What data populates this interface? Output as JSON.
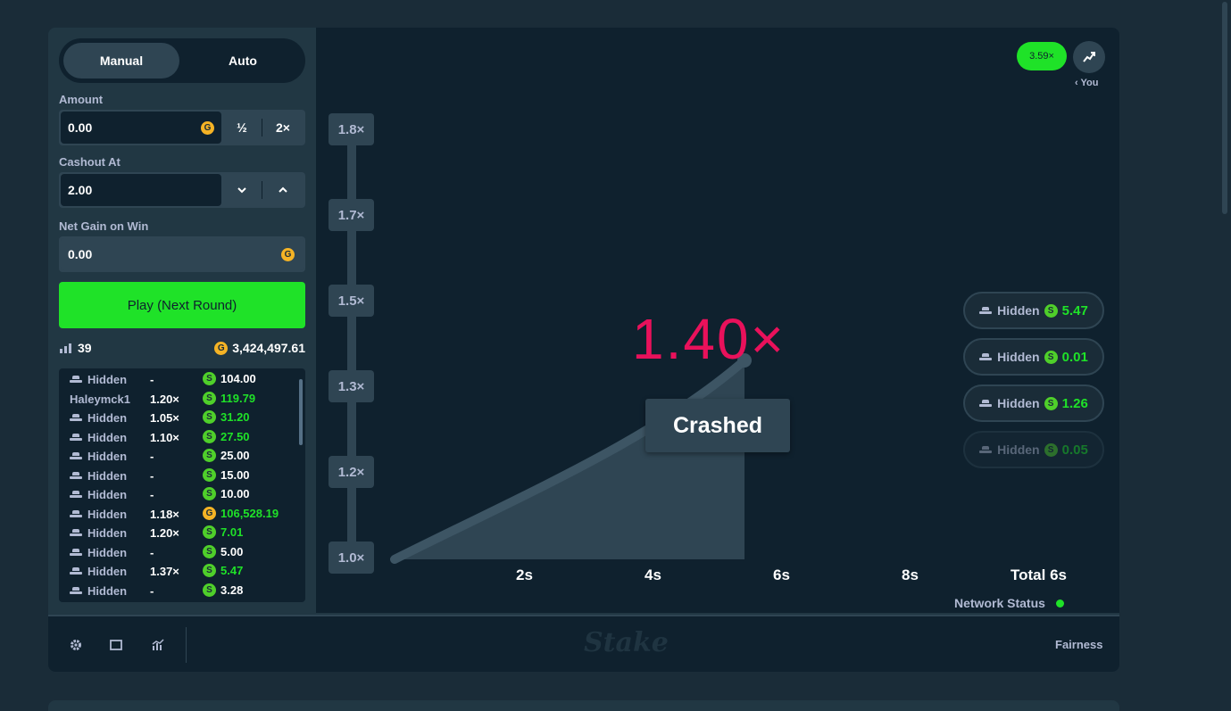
{
  "controls": {
    "tab_manual": "Manual",
    "tab_auto": "Auto",
    "amount_label": "Amount",
    "amount_value": "0.00",
    "half_label": "½",
    "double_label": "2×",
    "cashout_label": "Cashout At",
    "cashout_value": "2.00",
    "net_gain_label": "Net Gain on Win",
    "net_gain_value": "0.00",
    "play_label": "Play (Next Round)",
    "coin_g": "G",
    "coin_s": "S"
  },
  "stats": {
    "players": "39",
    "total": "3,424,497.61"
  },
  "bets": [
    {
      "name": "Hidden",
      "hidden": true,
      "mult": "-",
      "coin": "S",
      "amount": "104.00",
      "won": false
    },
    {
      "name": "Haleymck1",
      "hidden": false,
      "mult": "1.20×",
      "coin": "S",
      "amount": "119.79",
      "won": true
    },
    {
      "name": "Hidden",
      "hidden": true,
      "mult": "1.05×",
      "coin": "S",
      "amount": "31.20",
      "won": true
    },
    {
      "name": "Hidden",
      "hidden": true,
      "mult": "1.10×",
      "coin": "S",
      "amount": "27.50",
      "won": true
    },
    {
      "name": "Hidden",
      "hidden": true,
      "mult": "-",
      "coin": "S",
      "amount": "25.00",
      "won": false
    },
    {
      "name": "Hidden",
      "hidden": true,
      "mult": "-",
      "coin": "S",
      "amount": "15.00",
      "won": false
    },
    {
      "name": "Hidden",
      "hidden": true,
      "mult": "-",
      "coin": "S",
      "amount": "10.00",
      "won": false
    },
    {
      "name": "Hidden",
      "hidden": true,
      "mult": "1.18×",
      "coin": "G",
      "amount": "106,528.19",
      "won": true
    },
    {
      "name": "Hidden",
      "hidden": true,
      "mult": "1.20×",
      "coin": "S",
      "amount": "7.01",
      "won": true
    },
    {
      "name": "Hidden",
      "hidden": true,
      "mult": "-",
      "coin": "S",
      "amount": "5.00",
      "won": false
    },
    {
      "name": "Hidden",
      "hidden": true,
      "mult": "1.37×",
      "coin": "S",
      "amount": "5.47",
      "won": true
    },
    {
      "name": "Hidden",
      "hidden": true,
      "mult": "-",
      "coin": "S",
      "amount": "3.28",
      "won": false
    }
  ],
  "game": {
    "last_result": "3.59×",
    "you_label": "You",
    "multiplier": "1.40×",
    "status": "Crashed",
    "y_ticks": [
      "1.8×",
      "1.7×",
      "1.5×",
      "1.3×",
      "1.2×",
      "1.0×"
    ],
    "x_ticks": [
      "2s",
      "4s",
      "6s",
      "8s"
    ],
    "total_time": "Total 6s",
    "network_status": "Network Status",
    "network_color": "#1fe228",
    "cashouts": [
      {
        "name": "Hidden",
        "coin": "S",
        "amount": "5.47"
      },
      {
        "name": "Hidden",
        "coin": "S",
        "amount": "0.01"
      },
      {
        "name": "Hidden",
        "coin": "S",
        "amount": "1.26"
      },
      {
        "name": "Hidden",
        "coin": "S",
        "amount": "0.05"
      }
    ]
  },
  "footer": {
    "brand": "Stake",
    "fairness": "Fairness"
  },
  "colors": {
    "accent_green": "#1fe228",
    "crash_pink": "#e9115b",
    "panel": "#213743",
    "dark": "#0f212e"
  }
}
